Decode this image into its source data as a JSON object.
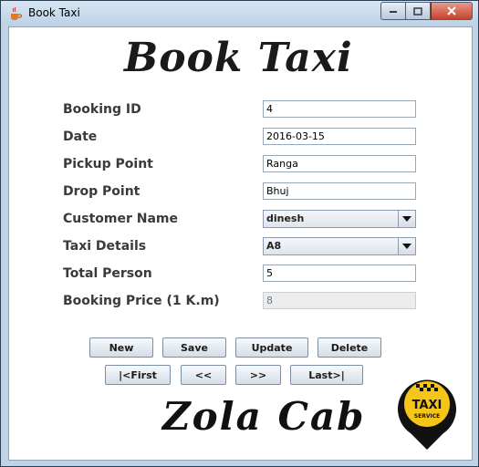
{
  "window": {
    "title": "Book Taxi"
  },
  "heading": "Book Taxi",
  "form": {
    "booking_id": {
      "label": "Booking ID",
      "value": "4"
    },
    "date": {
      "label": "Date",
      "value": "2016-03-15"
    },
    "pickup": {
      "label": "Pickup Point",
      "value": "Ranga"
    },
    "drop": {
      "label": "Drop Point",
      "value": "Bhuj"
    },
    "customer": {
      "label": "Customer Name",
      "value": "dinesh"
    },
    "taxi": {
      "label": "Taxi Details",
      "value": "A8"
    },
    "persons": {
      "label": "Total Person",
      "value": "5"
    },
    "price": {
      "label": "Booking Price (1 K.m)",
      "value": "8"
    }
  },
  "buttons": {
    "new": "New",
    "save": "Save",
    "update": "Update",
    "delete": "Delete",
    "first": "|<First",
    "prev": "<<",
    "next": ">>",
    "last": "Last>|"
  },
  "brand": "Zola Cab",
  "logo": {
    "line1": "TAXI",
    "line2": "SERVICE"
  }
}
